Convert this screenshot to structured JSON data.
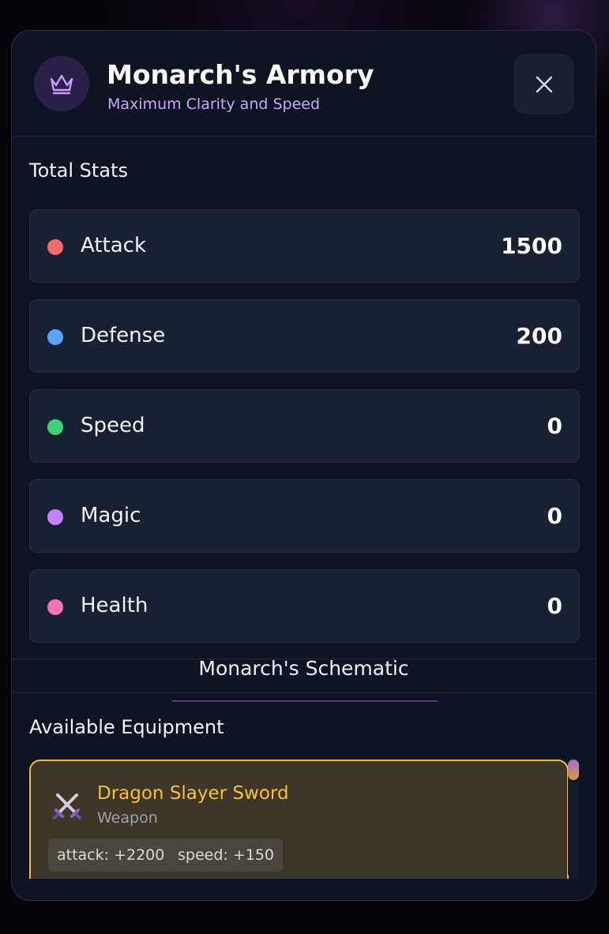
{
  "header": {
    "title": "Monarch's Armory",
    "subtitle": "Maximum Clarity and Speed",
    "badge_icon": "crown-icon",
    "close_icon": "close-icon"
  },
  "stats": {
    "heading": "Total Stats",
    "items": [
      {
        "label": "Attack",
        "value": "1500",
        "color": "#f56b6b"
      },
      {
        "label": "Defense",
        "value": "200",
        "color": "#5ea2ff"
      },
      {
        "label": "Speed",
        "value": "0",
        "color": "#3fd17a"
      },
      {
        "label": "Magic",
        "value": "0",
        "color": "#c084fc"
      },
      {
        "label": "Health",
        "value": "0",
        "color": "#f472b6"
      }
    ]
  },
  "schematic": {
    "tab_label": "Monarch's Schematic"
  },
  "equipment": {
    "heading": "Available Equipment",
    "items": [
      {
        "name": "Dragon Slayer Sword",
        "type": "Weapon",
        "icon": "crossed-swords-icon",
        "tags": [
          "attack: +2200",
          "speed: +150"
        ]
      }
    ]
  },
  "colors": {
    "accent_purple": "#c9a6f7",
    "highlight_gold": "#f3bd36",
    "panel_bg": "#0f1424"
  }
}
